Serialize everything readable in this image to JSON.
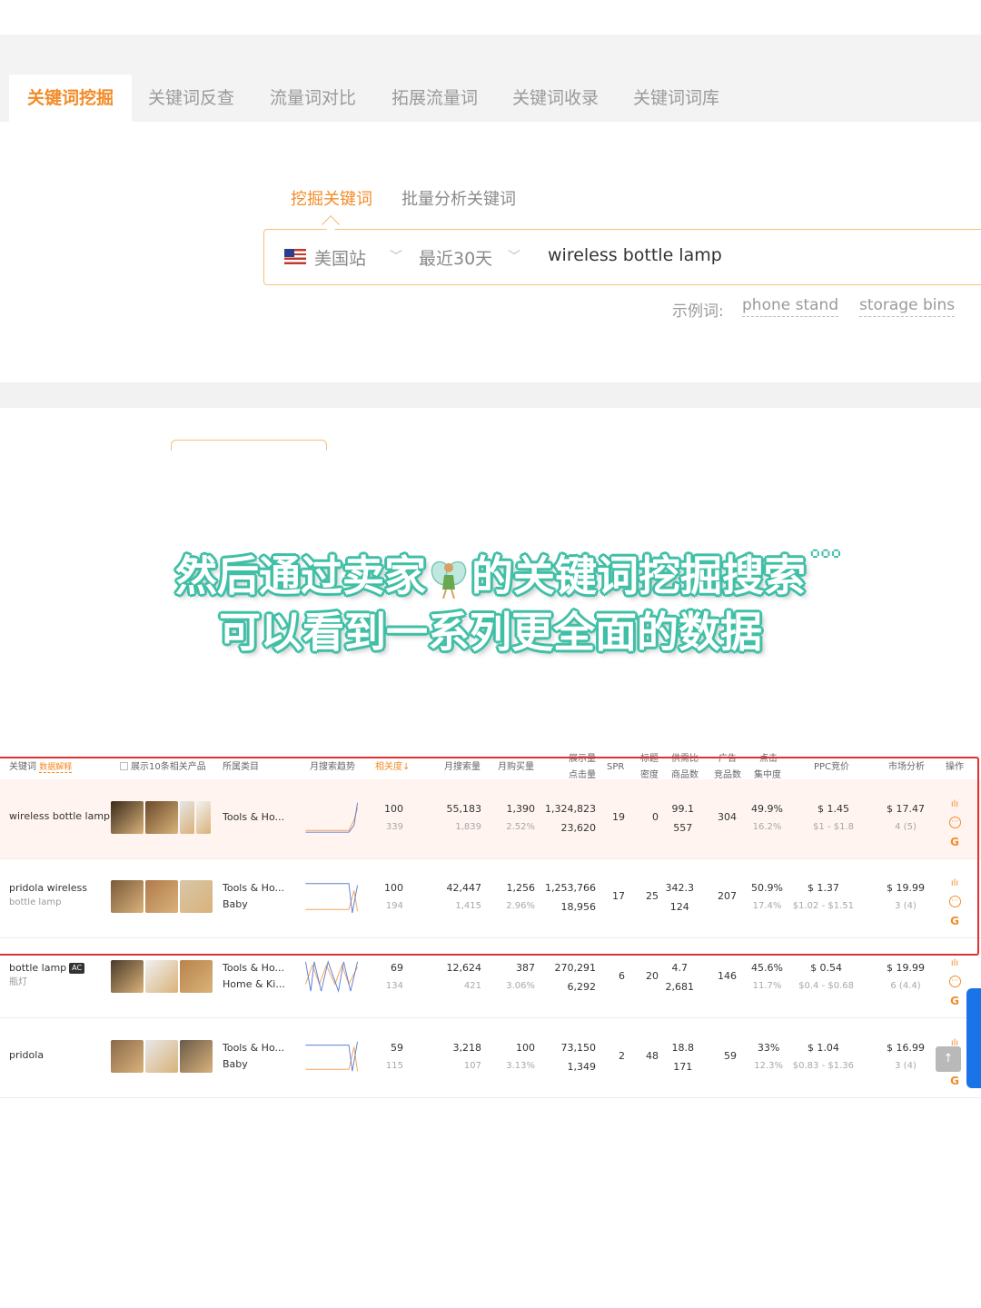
{
  "tabs": [
    "关键词挖掘",
    "关键词反查",
    "流量词对比",
    "拓展流量词",
    "关键词收录",
    "关键词词库"
  ],
  "subtabs": [
    "挖掘关键词",
    "批量分析关键词"
  ],
  "search": {
    "site": "美国站",
    "period": "最近30天",
    "query": "wireless bottle lamp"
  },
  "examples": {
    "label": "示例词:",
    "items": [
      "phone stand",
      "storage bins"
    ]
  },
  "overlay": {
    "line1_a": "然后通过卖家",
    "line1_b": "的关键词挖掘搜索",
    "dots": "...",
    "line2": "可以看到一系列更全面的数据"
  },
  "table": {
    "headers": {
      "keyword": "关键词",
      "keyword_link": "数据解释",
      "show_products": "展示10条相关产品",
      "category": "所属类目",
      "trend": "月搜索趋势",
      "relevance": "相关度↓",
      "monthly_search": "月搜索量",
      "monthly_purchase": "月购买量",
      "impressions": "展示量",
      "clicks": "点击量",
      "spr": "SPR",
      "title_density_a": "标题",
      "title_density_b": "密度",
      "supply_a": "供需比",
      "supply_b": "商品数",
      "ad_a": "广告",
      "ad_b": "竞品数",
      "click_a": "点击",
      "click_b": "集中度",
      "ppc": "PPC竞价",
      "market": "市场分析",
      "ops": "操作"
    },
    "rows": [
      {
        "keyword": "wireless bottle lamp",
        "keyword_sub": "",
        "badge": "",
        "cat1": "Tools & Ho...",
        "cat2": "",
        "rel": "100",
        "rel_sub": "339",
        "ms": "55,183",
        "ms_sub": "1,839",
        "mp": "1,390",
        "mp_sub": "2.52%",
        "imp": "1,324,823",
        "clk": "23,620",
        "spr": "19",
        "td": "0",
        "sd": "99.1",
        "sd_sub": "557",
        "ad": "304",
        "cc": "49.9%",
        "cc_sub": "16.2%",
        "ppc": "$ 1.45",
        "ppc_sub": "$1 - $1.8",
        "mk": "$ 17.47",
        "mk_sub": "4 (5)"
      },
      {
        "keyword": "pridola wireless",
        "keyword_sub": "bottle lamp",
        "badge": "",
        "cat1": "Tools & Ho...",
        "cat2": "Baby",
        "rel": "100",
        "rel_sub": "194",
        "ms": "42,447",
        "ms_sub": "1,415",
        "mp": "1,256",
        "mp_sub": "2.96%",
        "imp": "1,253,766",
        "clk": "18,956",
        "spr": "17",
        "td": "25",
        "sd": "342.3",
        "sd_sub": "124",
        "ad": "207",
        "cc": "50.9%",
        "cc_sub": "17.4%",
        "ppc": "$ 1.37",
        "ppc_sub": "$1.02 - $1.51",
        "mk": "$ 19.99",
        "mk_sub": "3 (4)"
      },
      {
        "keyword": "bottle lamp",
        "keyword_sub": "瓶灯",
        "badge": "AC",
        "cat1": "Tools & Ho...",
        "cat2": "Home & Ki...",
        "rel": "69",
        "rel_sub": "134",
        "ms": "12,624",
        "ms_sub": "421",
        "mp": "387",
        "mp_sub": "3.06%",
        "imp": "270,291",
        "clk": "6,292",
        "spr": "6",
        "td": "20",
        "sd": "4.7",
        "sd_sub": "2,681",
        "ad": "146",
        "cc": "45.6%",
        "cc_sub": "11.7%",
        "ppc": "$ 0.54",
        "ppc_sub": "$0.4 - $0.68",
        "mk": "$ 19.99",
        "mk_sub": "6 (4.4)"
      },
      {
        "keyword": "pridola",
        "keyword_sub": "",
        "badge": "",
        "cat1": "Tools & Ho...",
        "cat2": "Baby",
        "rel": "59",
        "rel_sub": "115",
        "ms": "3,218",
        "ms_sub": "107",
        "mp": "100",
        "mp_sub": "3.13%",
        "imp": "73,150",
        "clk": "1,349",
        "spr": "2",
        "td": "48",
        "sd": "18.8",
        "sd_sub": "171",
        "ad": "59",
        "cc": "33%",
        "cc_sub": "12.3%",
        "ppc": "$ 1.04",
        "ppc_sub": "$0.83 - $1.36",
        "mk": "$ 16.99",
        "mk_sub": "3 (4)"
      }
    ]
  },
  "colors": {
    "accent": "#f28c28",
    "highlight_border": "#e03131",
    "overlay_outline": "#3fbfa6"
  }
}
